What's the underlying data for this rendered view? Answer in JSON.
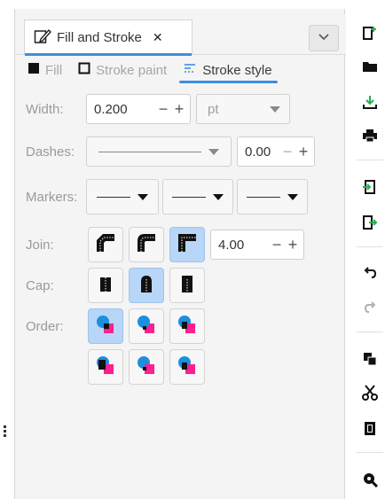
{
  "dock_tab": {
    "title": "Fill and Stroke",
    "close_glyph": "✕"
  },
  "subtabs": [
    {
      "label": "Fill",
      "icon": "fill-square-icon"
    },
    {
      "label": "Stroke paint",
      "icon": "stroke-square-icon"
    },
    {
      "label": "Stroke style",
      "icon": "stroke-style-icon"
    }
  ],
  "width": {
    "label": "Width:",
    "value": "0.200",
    "unit": "pt"
  },
  "dashes": {
    "label": "Dashes:",
    "offset": "0.00"
  },
  "markers": {
    "label": "Markers:"
  },
  "join": {
    "label": "Join:",
    "miter_limit": "4.00",
    "selected": "miter"
  },
  "cap": {
    "label": "Cap:",
    "selected": "round"
  },
  "order": {
    "label": "Order:",
    "selected": 0
  },
  "spin": {
    "minus": "−",
    "plus": "+"
  },
  "colors": {
    "accent": "#3d8ee0",
    "order_fill": "#ff1f8f",
    "order_stroke": "#1b8fe0"
  }
}
